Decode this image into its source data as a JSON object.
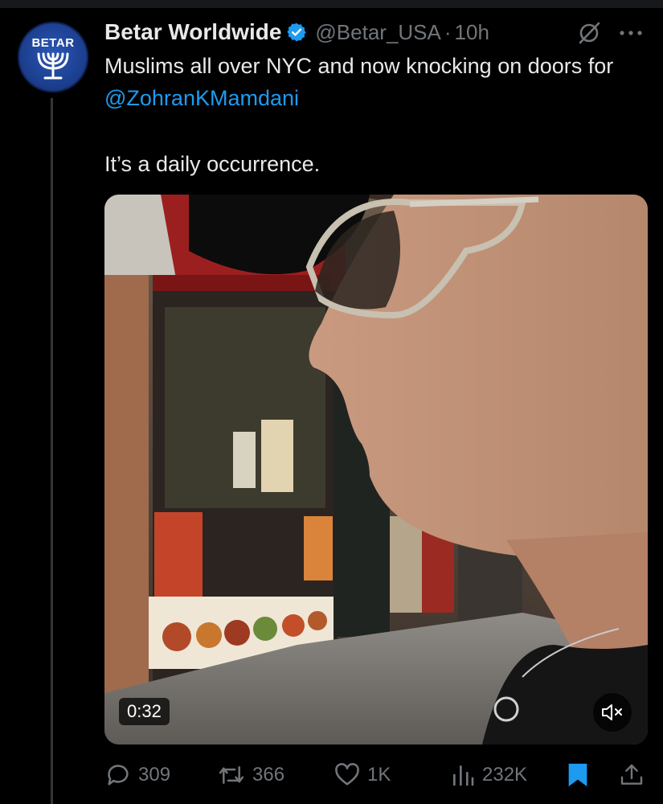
{
  "tweet": {
    "author_name": "Betar Worldwide",
    "handle": "@Betar_USA",
    "separator": "·",
    "time": "10h",
    "avatar_text": "BETAR",
    "text_line_prefix": "Muslims all over NYC and now knocking on doors for ",
    "mention": "@ZohranKMamdani",
    "text_second": "It’s a daily occurrence.",
    "verified": true
  },
  "video": {
    "duration": "0:32",
    "muted": true
  },
  "actions": {
    "replies": "309",
    "reposts": "366",
    "likes": "1K",
    "views": "232K",
    "bookmarked": true
  },
  "colors": {
    "background": "#000000",
    "text": "#e7e9ea",
    "secondary": "#71767b",
    "accent": "#1d9bf0"
  },
  "icons": [
    "verified-badge-icon",
    "grok-icon",
    "more-icon",
    "reply-icon",
    "repost-icon",
    "like-icon",
    "views-icon",
    "bookmark-icon",
    "share-icon",
    "mute-icon"
  ]
}
